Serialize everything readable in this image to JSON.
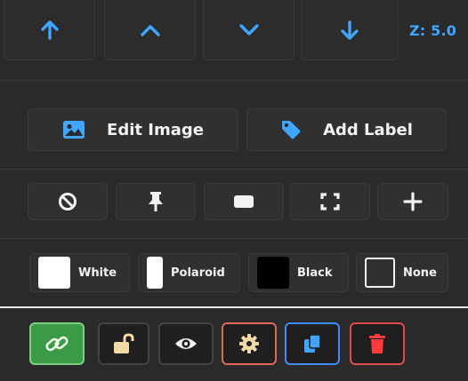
{
  "zorder": {
    "buttons": [
      {
        "name": "bring-forward-all-button",
        "icon": "arrow-up-icon"
      },
      {
        "name": "bring-forward-button",
        "icon": "chevron-up-icon"
      },
      {
        "name": "send-backward-button",
        "icon": "chevron-down-icon"
      },
      {
        "name": "send-to-back-button",
        "icon": "arrow-down-icon"
      }
    ],
    "z_label": "Z: 5.0",
    "accent": "#3fa5ff"
  },
  "edit": {
    "edit_image": "Edit Image",
    "add_label": "Add Label",
    "icon_color": "#3fa5ff"
  },
  "tools": [
    {
      "name": "block-button",
      "icon": "ban-icon"
    },
    {
      "name": "pin-button",
      "icon": "pin-icon"
    },
    {
      "name": "rectangle-button",
      "icon": "rectangle-icon"
    },
    {
      "name": "fullscreen-button",
      "icon": "expand-icon"
    },
    {
      "name": "add-button",
      "icon": "plus-icon"
    }
  ],
  "frames": {
    "white": "White",
    "polaroid": "Polaroid",
    "black": "Black",
    "none": "None"
  },
  "actions": [
    {
      "name": "link-button",
      "icon": "link-icon",
      "border": "#6fbf73",
      "bg": "#3a9a45"
    },
    {
      "name": "unlock-button",
      "icon": "unlock-icon",
      "border": "#444444"
    },
    {
      "name": "visibility-button",
      "icon": "eye-icon",
      "border": "#444444"
    },
    {
      "name": "settings-button",
      "icon": "gear-icon",
      "border": "#e0675a"
    },
    {
      "name": "duplicate-button",
      "icon": "copy-icon",
      "border": "#3f8cff"
    },
    {
      "name": "delete-button",
      "icon": "trash-icon",
      "border": "#e04a4a"
    }
  ]
}
